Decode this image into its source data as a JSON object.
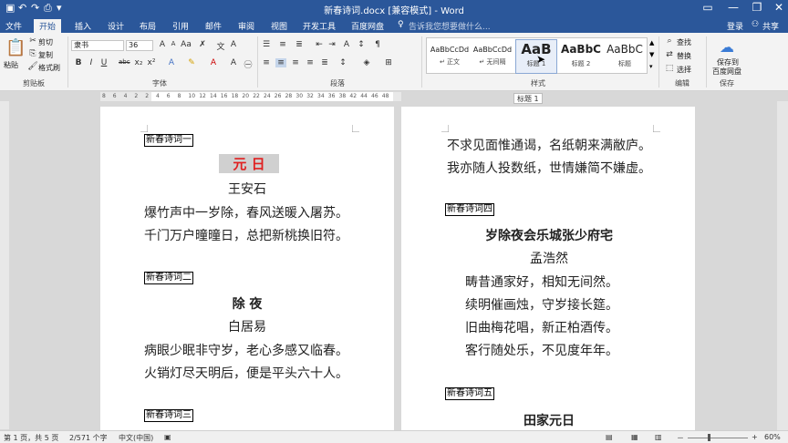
{
  "window": {
    "title": "新春诗词.docx [兼容模式] - Word",
    "minimize": "—",
    "restore": "❐",
    "close": "✕",
    "quick_undo": "↶",
    "quick_redo": "↷"
  },
  "tabs": [
    "文件",
    "开始",
    "插入",
    "设计",
    "布局",
    "引用",
    "邮件",
    "审阅",
    "视图",
    "开发工具",
    "百度网盘"
  ],
  "tell_me": "告诉我您想要做什么...",
  "login": "登录",
  "share": "共享",
  "clipboard": {
    "paste": "粘贴",
    "cut": "剪切",
    "copy": "复制",
    "format_painter": "格式刷",
    "group": "剪贴板"
  },
  "font": {
    "name": "隶书",
    "size": "36",
    "group": "字体"
  },
  "paragraph": {
    "group": "段落"
  },
  "styles": {
    "group": "样式",
    "items": [
      {
        "preview": "AaBbCcDd",
        "name": "↵ 正文"
      },
      {
        "preview": "AaBbCcDd",
        "name": "↵ 无间隔"
      },
      {
        "preview": "AaB",
        "name": "标题 1"
      },
      {
        "preview": "AaBbC",
        "name": "标题 2"
      },
      {
        "preview": "AaBbC",
        "name": "标题"
      }
    ]
  },
  "editing": {
    "find": "查找",
    "replace": "替换",
    "select": "选择",
    "group": "编辑"
  },
  "save": {
    "label1": "保存到",
    "label2": "百度网盘",
    "group": "保存"
  },
  "tooltip": "标题 1",
  "ruler_marks": [
    "8",
    "6",
    "4",
    "2",
    "2",
    "4",
    "6",
    "8",
    "10",
    "12",
    "14",
    "16",
    "18",
    "20",
    "22",
    "24",
    "26",
    "28",
    "30",
    "32",
    "34",
    "36",
    "38",
    "42",
    "44",
    "46",
    "48"
  ],
  "page1": {
    "label1": "新春诗词一",
    "title1": "元  日",
    "author1": "王安石",
    "l1": "爆竹声中一岁除，春风送暖入屠苏。",
    "l2": "千门万户曈曈日，总把新桃换旧符。",
    "label2": "新春诗词二",
    "title2": "除  夜",
    "author2": "白居易",
    "l3": "病眼少眠非守岁，老心多感又临春。",
    "l4": "火销灯尽天明后，便是平头六十人。",
    "label3": "新春诗词三"
  },
  "page2": {
    "l1": "不求见面惟通谒，名纸朝来满敝庐。",
    "l2": "我亦随人投数纸，世情嫌简不嫌虚。",
    "label4": "新春诗词四",
    "title4": "岁除夜会乐城张少府宅",
    "author4": "孟浩然",
    "l3": "畴昔通家好，相知无间然。",
    "l4": "续明催画烛，守岁接长筵。",
    "l5": "旧曲梅花唱，新正柏酒传。",
    "l6": "客行随处乐，不见度年年。",
    "label5": "新春诗词五",
    "title5": "田家元日"
  },
  "status": {
    "page": "第 1 页，共 5 页",
    "words": "2/571 个字",
    "lang": "中文(中国)",
    "zoom": "60%",
    "zoom_minus": "－",
    "zoom_plus": "+"
  }
}
